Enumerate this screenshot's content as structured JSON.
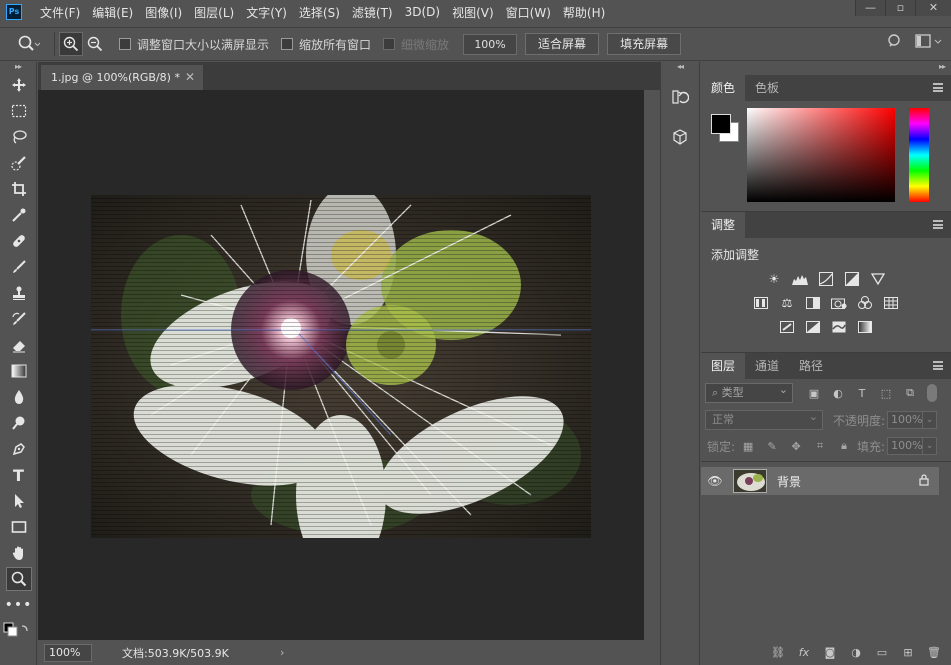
{
  "app": {
    "logo": "Ps",
    "menu": [
      "文件(F)",
      "编辑(E)",
      "图像(I)",
      "图层(L)",
      "文字(Y)",
      "选择(S)",
      "滤镜(T)",
      "3D(D)",
      "视图(V)",
      "窗口(W)",
      "帮助(H)"
    ],
    "window_controls": [
      "minimize-icon",
      "restore-icon",
      "close-icon"
    ]
  },
  "options_bar": {
    "active_tool_icon": "zoom-icon",
    "check_resize_windows": "调整窗口大小以满屏显示",
    "check_zoom_all": "缩放所有窗口",
    "check_scrubby": "细微缩放",
    "zoom_value": "100%",
    "fit_screen": "适合屏幕",
    "fill_screen": "填充屏幕"
  },
  "toolbar": {
    "tools": [
      "move-icon",
      "marquee-icon",
      "lasso-icon",
      "quick-select-icon",
      "crop-icon",
      "eyedropper-icon",
      "healing-icon",
      "brush-icon",
      "stamp-icon",
      "history-brush-icon",
      "eraser-icon",
      "gradient-icon",
      "blur-icon",
      "dodge-icon",
      "pen-icon",
      "type-icon",
      "path-select-icon",
      "rectangle-icon",
      "hand-icon",
      "zoom-icon",
      "more-icon"
    ],
    "active_tool": "zoom-icon"
  },
  "document": {
    "tab_title": "1.jpg @ 100%(RGB/8) *",
    "status_zoom": "100%",
    "status_info": "文档:503.9K/503.9K"
  },
  "panels": {
    "color": {
      "tabs": [
        "颜色",
        "色板"
      ],
      "active": 0,
      "foreground": "#000000",
      "background": "#ffffff"
    },
    "adjustments": {
      "tab": "调整",
      "title": "添加调整",
      "rows": [
        [
          "brightness-icon",
          "levels-icon",
          "curves-icon",
          "exposure-icon",
          "vibrance-icon"
        ],
        [
          "hue-sat-icon",
          "color-balance-icon",
          "bw-icon",
          "photo-filter-icon",
          "channel-mixer-icon",
          "color-lookup-icon"
        ],
        [
          "invert-icon",
          "posterize-icon",
          "threshold-icon",
          "gradient-map-icon"
        ]
      ]
    },
    "layers": {
      "tabs": [
        "图层",
        "通道",
        "路径"
      ],
      "active": 0,
      "kind_placeholder": "类型",
      "blend_mode": "正常",
      "opacity_label": "不透明度:",
      "opacity_value": "100%",
      "lock_label": "锁定:",
      "fill_label": "填充:",
      "fill_value": "100%",
      "items": [
        {
          "name": "背景",
          "visible": true,
          "locked": true
        }
      ]
    }
  }
}
